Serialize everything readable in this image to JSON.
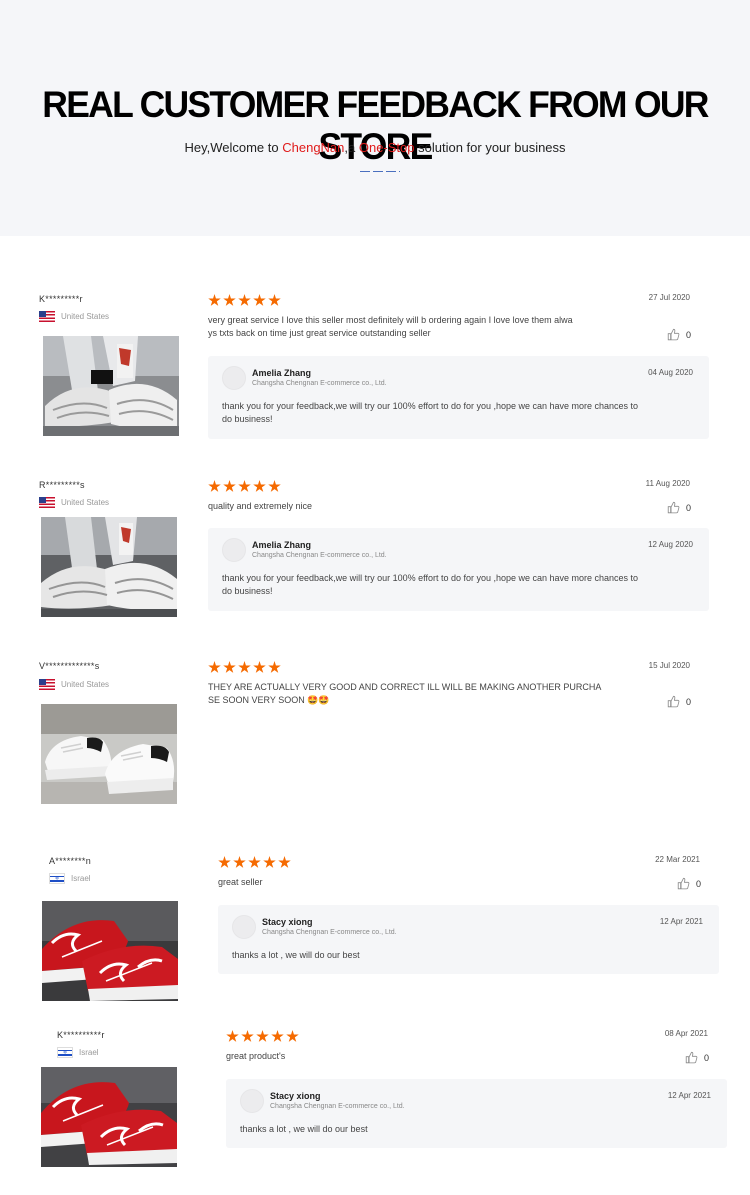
{
  "header": {
    "title": "REAL CUSTOMER FEEDBACK FROM OUR STORE",
    "subtitle_pre": "Hey,Welcome to ",
    "subtitle_brand": "ChengNan",
    "subtitle_mid": ",a ",
    "subtitle_accent": "One-Stop",
    "subtitle_post": " solution for your business",
    "accent_color": "#e01b1b"
  },
  "reviews": [
    {
      "user": "K*********r",
      "country": "United States",
      "flag_icon": "us-flag-icon",
      "rating": 5,
      "date": "27 Jul 2020",
      "text_line1": "very great service I love this seller most definitely will b ordering again I love love them alwa",
      "text_line2": "ys txts back on time just great service outstanding seller",
      "likes": "0",
      "reply": {
        "name": "Amelia Zhang",
        "company": "Changsha Chengnan E-commerce co., Ltd.",
        "date": "04 Aug 2020",
        "text_line1": "thank you for your feedback,we will try our 100% effort to do for you ,hope we can have more chances to",
        "text_line2": "do business!"
      }
    },
    {
      "user": "R*********s",
      "country": "United States",
      "flag_icon": "us-flag-icon",
      "rating": 5,
      "date": "11 Aug 2020",
      "text_line1": "quality and extremely nice",
      "likes": "0",
      "reply": {
        "name": "Amelia Zhang",
        "company": "Changsha Chengnan E-commerce co., Ltd.",
        "date": "12 Aug 2020",
        "text_line1": "thank you for your feedback,we will try our 100% effort to do for you ,hope we can have more chances to",
        "text_line2": "do business!"
      }
    },
    {
      "user": "V*************s",
      "country": "United States",
      "flag_icon": "us-flag-icon",
      "rating": 5,
      "date": "15 Jul 2020",
      "text_line1": "THEY ARE ACTUALLY VERY GOOD AND CORRECT ILL WILL BE MAKING ANOTHER PURCHA",
      "text_line2": "SE SOON VERY SOON 🤩🤩",
      "likes": "0"
    },
    {
      "user": "A********n",
      "country": "Israel",
      "flag_icon": "israel-flag-icon",
      "rating": 5,
      "date": "22 Mar 2021",
      "text_line1": "great seller",
      "likes": "0",
      "reply": {
        "name": "Stacy xiong",
        "company": "Changsha Chengnan E-commerce co., Ltd.",
        "date": "12 Apr 2021",
        "text_line1": "thanks a lot , we will do our best"
      }
    },
    {
      "user": "K**********r",
      "country": "Israel",
      "flag_icon": "israel-flag-icon",
      "rating": 5,
      "date": "08 Apr 2021",
      "text_line1": "great product's",
      "likes": "0",
      "reply": {
        "name": "Stacy xiong",
        "company": "Changsha Chengnan E-commerce co., Ltd.",
        "date": "12 Apr 2021",
        "text_line1": "thanks a lot , we will do our best"
      }
    }
  ]
}
